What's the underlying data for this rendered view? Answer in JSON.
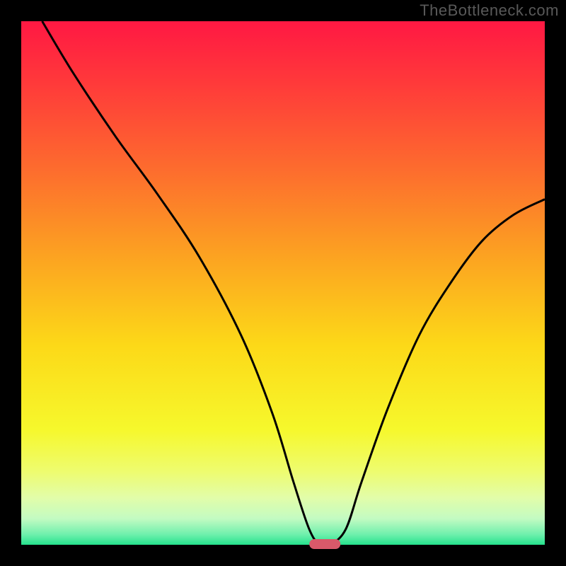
{
  "watermark": "TheBottleneck.com",
  "colors": {
    "frame": "#000000",
    "curve": "#000000",
    "marker_fill": "#d9596a",
    "gradient_stops": [
      {
        "offset": 0.0,
        "color": "#ff1843"
      },
      {
        "offset": 0.12,
        "color": "#ff3a3a"
      },
      {
        "offset": 0.28,
        "color": "#fd6b2e"
      },
      {
        "offset": 0.45,
        "color": "#fca321"
      },
      {
        "offset": 0.62,
        "color": "#fcd918"
      },
      {
        "offset": 0.78,
        "color": "#f6f82c"
      },
      {
        "offset": 0.86,
        "color": "#eefc6f"
      },
      {
        "offset": 0.91,
        "color": "#e2fda9"
      },
      {
        "offset": 0.95,
        "color": "#c3fbc2"
      },
      {
        "offset": 0.98,
        "color": "#70f0ad"
      },
      {
        "offset": 1.0,
        "color": "#26e28d"
      }
    ]
  },
  "chart_data": {
    "type": "line",
    "title": "",
    "xlabel": "",
    "ylabel": "",
    "xlim": [
      0,
      100
    ],
    "ylim": [
      0,
      100
    ],
    "series": [
      {
        "name": "bottleneck-curve",
        "x": [
          4,
          10,
          18,
          26,
          34,
          42,
          48,
          52,
          55,
          57,
          59,
          62,
          65,
          70,
          76,
          82,
          88,
          94,
          100
        ],
        "y": [
          100,
          90,
          78,
          67,
          55,
          40,
          25,
          12,
          3,
          0,
          0,
          3,
          12,
          26,
          40,
          50,
          58,
          63,
          66
        ]
      }
    ],
    "annotations": [
      {
        "name": "optimal-marker",
        "x": 58,
        "y": 0,
        "shape": "pill"
      }
    ]
  }
}
